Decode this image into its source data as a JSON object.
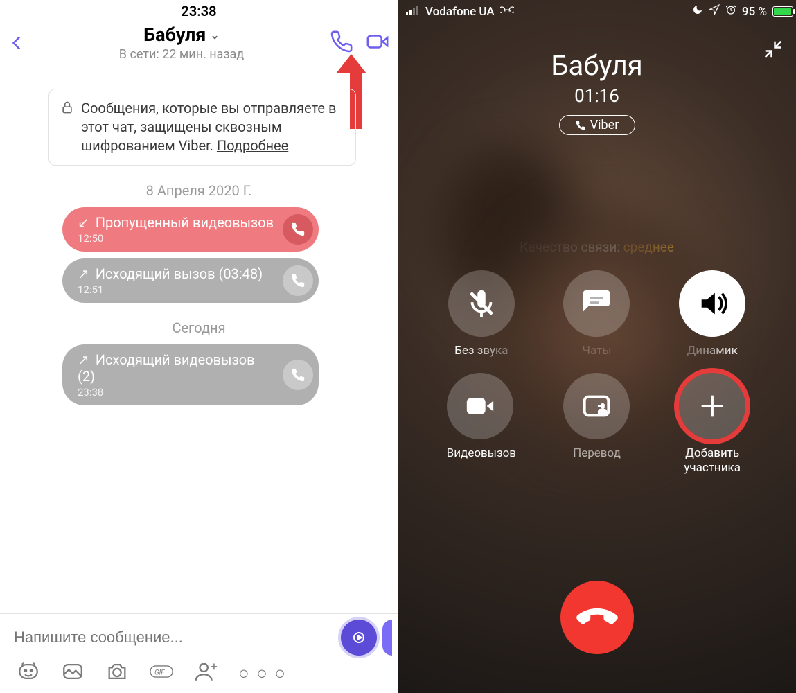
{
  "left": {
    "status_time": "23:38",
    "contact_name": "Бабуля",
    "subtitle": "В сети: 22 мин. назад",
    "encryption_text": "Сообщения, которые вы отправляете в этот чат, защищены сквозным шифрованием Viber.",
    "encryption_more": "Подробнее",
    "date1": "8 Апреля 2020 Г.",
    "date2": "Сегодня",
    "calls": [
      {
        "label": "Пропущенный видеовызов",
        "time": "12:50"
      },
      {
        "label": "Исходящий вызов (03:48)",
        "time": "12:51"
      },
      {
        "label": "Исходящий видеовызов (2)",
        "time": "23:38"
      }
    ],
    "input_placeholder": "Напишите сообщение..."
  },
  "right": {
    "carrier": "Vodafone UA",
    "battery_text": "95 %",
    "contact_name": "Бабуля",
    "call_duration": "01:16",
    "badge": "Viber",
    "quality_label": "Качество связи: ",
    "quality_value": "среднее",
    "controls": [
      {
        "label": "Без звука"
      },
      {
        "label": "Чаты"
      },
      {
        "label": "Динамик"
      },
      {
        "label": "Видеовызов"
      },
      {
        "label": "Перевод"
      },
      {
        "label": "Добавить\nучастника"
      }
    ]
  }
}
